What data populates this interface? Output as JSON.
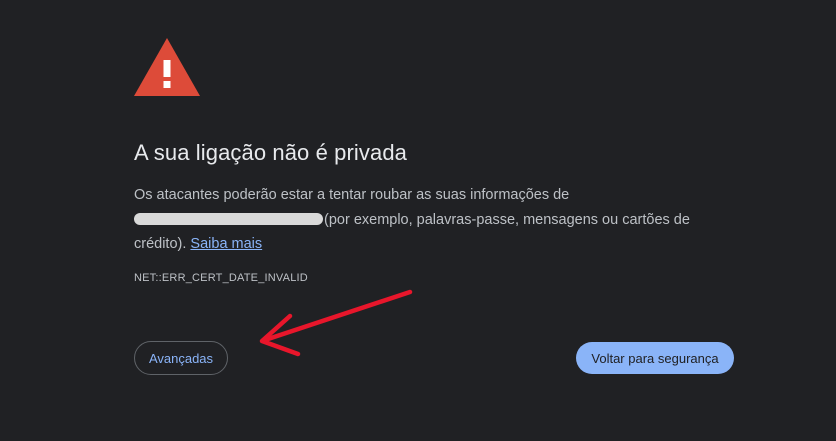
{
  "interstitial": {
    "heading": "A sua ligação não é privada",
    "explanation_before": "Os atacantes poderão estar a tentar roubar as suas informações de",
    "explanation_after": "(por exemplo, palavras-passe, mensagens ou cartões de crédito).",
    "learn_more_label": "Saiba mais",
    "error_code": "NET::ERR_CERT_DATE_INVALID"
  },
  "buttons": {
    "advanced_label": "Avançadas",
    "back_to_safety_label": "Voltar para segurança"
  },
  "icons": {
    "warning": "warning-triangle-icon",
    "annotation": "red-arrow-annotation"
  },
  "colors": {
    "background": "#202124",
    "warning_red": "#dd4b39",
    "link_blue": "#8ab4f8",
    "annotation_red": "#e8162b"
  }
}
